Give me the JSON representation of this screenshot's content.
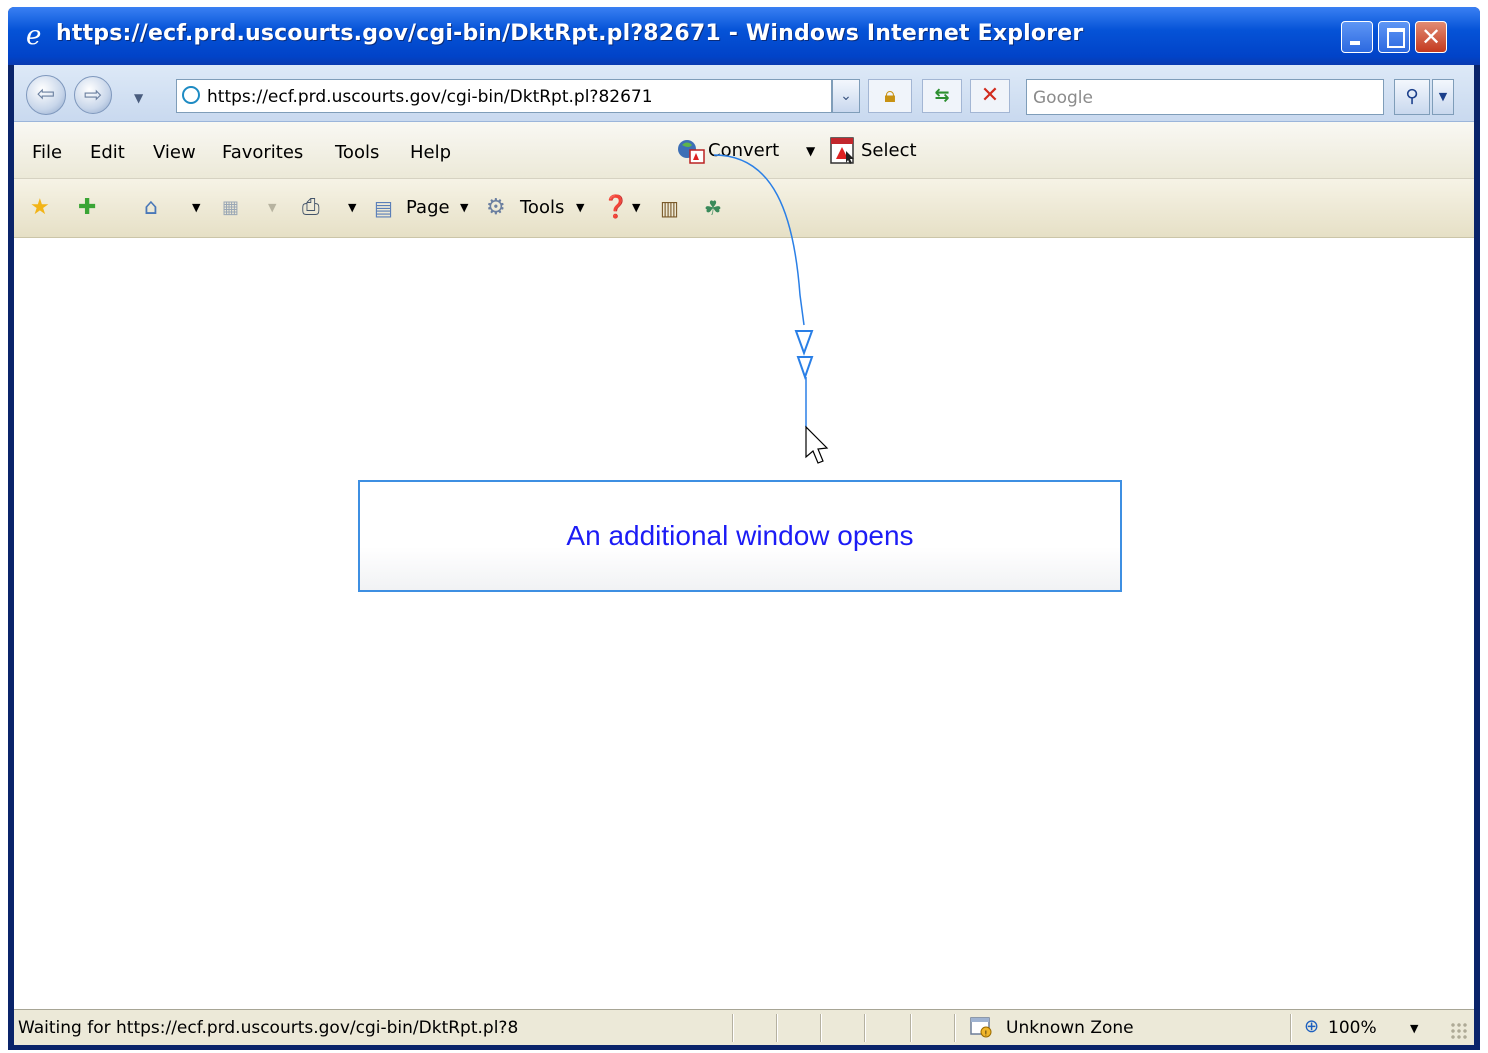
{
  "window": {
    "title": "https://ecf.prd.uscourts.gov/cgi-bin/DktRpt.pl?82671 - Windows Internet Explorer"
  },
  "address_bar": {
    "url": "https://ecf.prd.uscourts.gov/cgi-bin/DktRpt.pl?82671",
    "search_placeholder": "Google"
  },
  "menu": {
    "items": [
      "File",
      "Edit",
      "View",
      "Favorites",
      "Tools",
      "Help"
    ],
    "convert_label": "Convert",
    "select_label": "Select"
  },
  "command_bar": {
    "page_label": "Page",
    "tools_label": "Tools"
  },
  "callout": {
    "text": "An additional window opens",
    "color": "#1c1cf5",
    "border_color": "#3d8fe2"
  },
  "status_bar": {
    "status_text": "Waiting for https://ecf.prd.uscourts.gov/cgi-bin/DktRpt.pl?8",
    "zone_text": "Unknown Zone",
    "zoom_text": "100%"
  },
  "colors": {
    "titlebar": "#0553d7",
    "annotation_line": "#2a7fe6"
  }
}
